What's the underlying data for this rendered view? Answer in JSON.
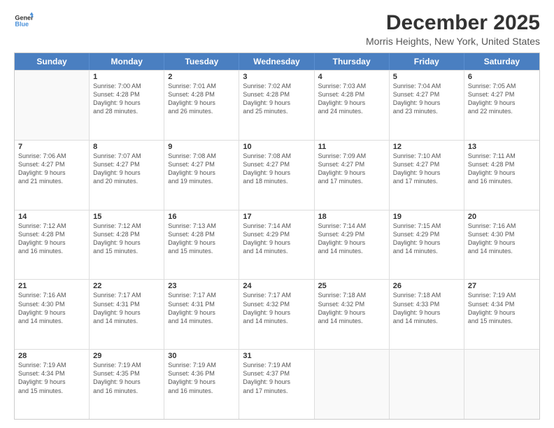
{
  "logo": {
    "line1": "General",
    "line2": "Blue"
  },
  "title": "December 2025",
  "subtitle": "Morris Heights, New York, United States",
  "header_days": [
    "Sunday",
    "Monday",
    "Tuesday",
    "Wednesday",
    "Thursday",
    "Friday",
    "Saturday"
  ],
  "weeks": [
    [
      {
        "day": "",
        "lines": []
      },
      {
        "day": "1",
        "lines": [
          "Sunrise: 7:00 AM",
          "Sunset: 4:28 PM",
          "Daylight: 9 hours",
          "and 28 minutes."
        ]
      },
      {
        "day": "2",
        "lines": [
          "Sunrise: 7:01 AM",
          "Sunset: 4:28 PM",
          "Daylight: 9 hours",
          "and 26 minutes."
        ]
      },
      {
        "day": "3",
        "lines": [
          "Sunrise: 7:02 AM",
          "Sunset: 4:28 PM",
          "Daylight: 9 hours",
          "and 25 minutes."
        ]
      },
      {
        "day": "4",
        "lines": [
          "Sunrise: 7:03 AM",
          "Sunset: 4:28 PM",
          "Daylight: 9 hours",
          "and 24 minutes."
        ]
      },
      {
        "day": "5",
        "lines": [
          "Sunrise: 7:04 AM",
          "Sunset: 4:27 PM",
          "Daylight: 9 hours",
          "and 23 minutes."
        ]
      },
      {
        "day": "6",
        "lines": [
          "Sunrise: 7:05 AM",
          "Sunset: 4:27 PM",
          "Daylight: 9 hours",
          "and 22 minutes."
        ]
      }
    ],
    [
      {
        "day": "7",
        "lines": [
          "Sunrise: 7:06 AM",
          "Sunset: 4:27 PM",
          "Daylight: 9 hours",
          "and 21 minutes."
        ]
      },
      {
        "day": "8",
        "lines": [
          "Sunrise: 7:07 AM",
          "Sunset: 4:27 PM",
          "Daylight: 9 hours",
          "and 20 minutes."
        ]
      },
      {
        "day": "9",
        "lines": [
          "Sunrise: 7:08 AM",
          "Sunset: 4:27 PM",
          "Daylight: 9 hours",
          "and 19 minutes."
        ]
      },
      {
        "day": "10",
        "lines": [
          "Sunrise: 7:08 AM",
          "Sunset: 4:27 PM",
          "Daylight: 9 hours",
          "and 18 minutes."
        ]
      },
      {
        "day": "11",
        "lines": [
          "Sunrise: 7:09 AM",
          "Sunset: 4:27 PM",
          "Daylight: 9 hours",
          "and 17 minutes."
        ]
      },
      {
        "day": "12",
        "lines": [
          "Sunrise: 7:10 AM",
          "Sunset: 4:27 PM",
          "Daylight: 9 hours",
          "and 17 minutes."
        ]
      },
      {
        "day": "13",
        "lines": [
          "Sunrise: 7:11 AM",
          "Sunset: 4:28 PM",
          "Daylight: 9 hours",
          "and 16 minutes."
        ]
      }
    ],
    [
      {
        "day": "14",
        "lines": [
          "Sunrise: 7:12 AM",
          "Sunset: 4:28 PM",
          "Daylight: 9 hours",
          "and 16 minutes."
        ]
      },
      {
        "day": "15",
        "lines": [
          "Sunrise: 7:12 AM",
          "Sunset: 4:28 PM",
          "Daylight: 9 hours",
          "and 15 minutes."
        ]
      },
      {
        "day": "16",
        "lines": [
          "Sunrise: 7:13 AM",
          "Sunset: 4:28 PM",
          "Daylight: 9 hours",
          "and 15 minutes."
        ]
      },
      {
        "day": "17",
        "lines": [
          "Sunrise: 7:14 AM",
          "Sunset: 4:29 PM",
          "Daylight: 9 hours",
          "and 14 minutes."
        ]
      },
      {
        "day": "18",
        "lines": [
          "Sunrise: 7:14 AM",
          "Sunset: 4:29 PM",
          "Daylight: 9 hours",
          "and 14 minutes."
        ]
      },
      {
        "day": "19",
        "lines": [
          "Sunrise: 7:15 AM",
          "Sunset: 4:29 PM",
          "Daylight: 9 hours",
          "and 14 minutes."
        ]
      },
      {
        "day": "20",
        "lines": [
          "Sunrise: 7:16 AM",
          "Sunset: 4:30 PM",
          "Daylight: 9 hours",
          "and 14 minutes."
        ]
      }
    ],
    [
      {
        "day": "21",
        "lines": [
          "Sunrise: 7:16 AM",
          "Sunset: 4:30 PM",
          "Daylight: 9 hours",
          "and 14 minutes."
        ]
      },
      {
        "day": "22",
        "lines": [
          "Sunrise: 7:17 AM",
          "Sunset: 4:31 PM",
          "Daylight: 9 hours",
          "and 14 minutes."
        ]
      },
      {
        "day": "23",
        "lines": [
          "Sunrise: 7:17 AM",
          "Sunset: 4:31 PM",
          "Daylight: 9 hours",
          "and 14 minutes."
        ]
      },
      {
        "day": "24",
        "lines": [
          "Sunrise: 7:17 AM",
          "Sunset: 4:32 PM",
          "Daylight: 9 hours",
          "and 14 minutes."
        ]
      },
      {
        "day": "25",
        "lines": [
          "Sunrise: 7:18 AM",
          "Sunset: 4:32 PM",
          "Daylight: 9 hours",
          "and 14 minutes."
        ]
      },
      {
        "day": "26",
        "lines": [
          "Sunrise: 7:18 AM",
          "Sunset: 4:33 PM",
          "Daylight: 9 hours",
          "and 14 minutes."
        ]
      },
      {
        "day": "27",
        "lines": [
          "Sunrise: 7:19 AM",
          "Sunset: 4:34 PM",
          "Daylight: 9 hours",
          "and 15 minutes."
        ]
      }
    ],
    [
      {
        "day": "28",
        "lines": [
          "Sunrise: 7:19 AM",
          "Sunset: 4:34 PM",
          "Daylight: 9 hours",
          "and 15 minutes."
        ]
      },
      {
        "day": "29",
        "lines": [
          "Sunrise: 7:19 AM",
          "Sunset: 4:35 PM",
          "Daylight: 9 hours",
          "and 16 minutes."
        ]
      },
      {
        "day": "30",
        "lines": [
          "Sunrise: 7:19 AM",
          "Sunset: 4:36 PM",
          "Daylight: 9 hours",
          "and 16 minutes."
        ]
      },
      {
        "day": "31",
        "lines": [
          "Sunrise: 7:19 AM",
          "Sunset: 4:37 PM",
          "Daylight: 9 hours",
          "and 17 minutes."
        ]
      },
      {
        "day": "",
        "lines": []
      },
      {
        "day": "",
        "lines": []
      },
      {
        "day": "",
        "lines": []
      }
    ]
  ]
}
